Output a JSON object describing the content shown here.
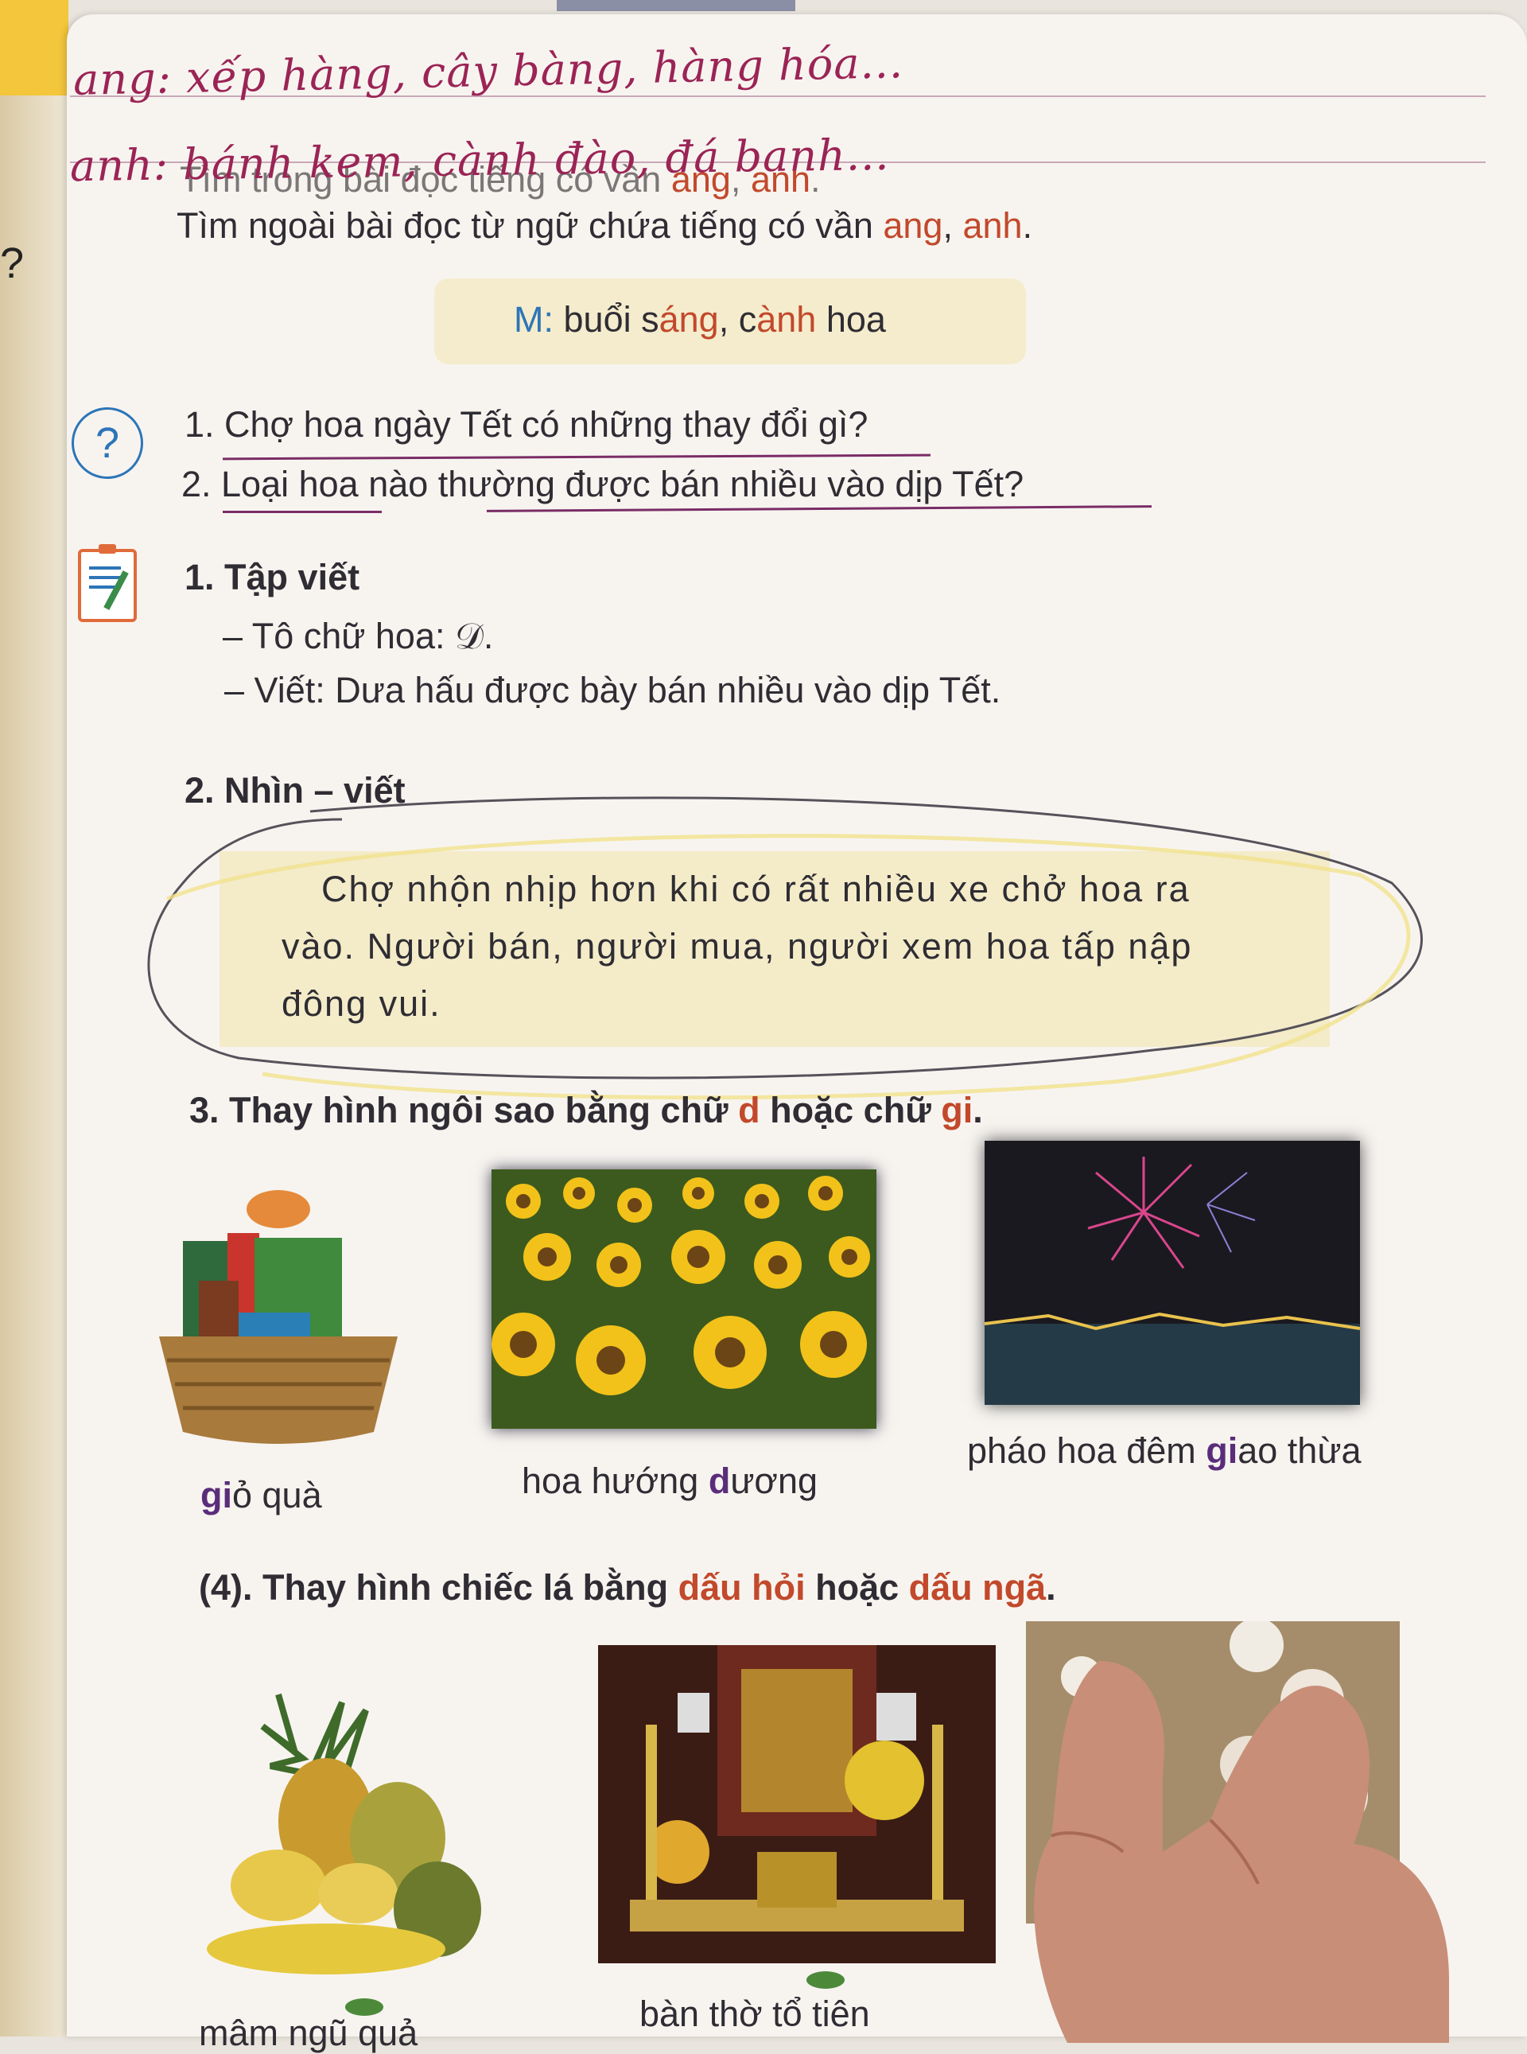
{
  "handwriting": {
    "line1": "ang: xếp hàng, cây bàng, hàng hóa...",
    "line2": "anh: bánh kem, cành đào, đá banh..."
  },
  "exercise_vowel": {
    "line1_pre": "Tìm trong bài đọc tiếng có vần ",
    "line1_ang": "ang",
    "line1_sep": ", ",
    "line1_anh": "anh",
    "line1_end": ".",
    "line2_pre": "Tìm ngoài bài đọc từ ngữ chứa tiếng có vần ",
    "line2_ang": "ang",
    "line2_sep": ", ",
    "line2_anh": "anh",
    "line2_end": "."
  },
  "model": {
    "label": "M:",
    "w1a": "buổi s",
    "w1b": "áng",
    "sep": ", ",
    "w2a": "c",
    "w2b": "ành",
    "w2c": " hoa"
  },
  "questions": {
    "icon": "?",
    "q1": "1. Chợ hoa ngày Tết có những thay đổi gì?",
    "q2": "2. Loại hoa nào thường được bán nhiều vào dịp Tết?"
  },
  "writing": {
    "title": "1. Tập viết",
    "trace": "– Tô chữ hoa: 𝒟.",
    "write": "– Viết: Dưa hấu được bày bán nhiều vào dịp Tết."
  },
  "copy": {
    "title": "2. Nhìn – viết",
    "p1": "Chợ nhộn nhịp hơn khi có rất nhiều xe chở hoa ra",
    "p2": "vào. Người bán, người mua, người xem hoa tấp nập",
    "p3": "đông vui."
  },
  "ex3": {
    "pre": "3. Thay hình ngôi sao bằng chữ ",
    "d": "d",
    "mid": " hoặc chữ ",
    "gi": "gi",
    "end": ".",
    "cap1_mark": "gi",
    "cap1": "ỏ quà",
    "cap2_pre": "hoa hướng ",
    "cap2_mark": "d",
    "cap2": "ương",
    "cap3_pre": "pháo hoa đêm ",
    "cap3_mark": "gi",
    "cap3": "ao thừa"
  },
  "ex4": {
    "pre": "(4). Thay hình chiếc lá bằng ",
    "hoi": "dấu hỏi",
    "mid": " hoặc ",
    "nga": "dấu ngã",
    "end": ".",
    "cap1": "mâm ngũ quả",
    "cap2": "bàn thờ tổ tiên"
  },
  "colors": {
    "accent_red": "#c2492b",
    "accent_blue": "#2d75b8",
    "handwriting": "#9b2455",
    "highlight_yellow": "#f4ebc9"
  }
}
